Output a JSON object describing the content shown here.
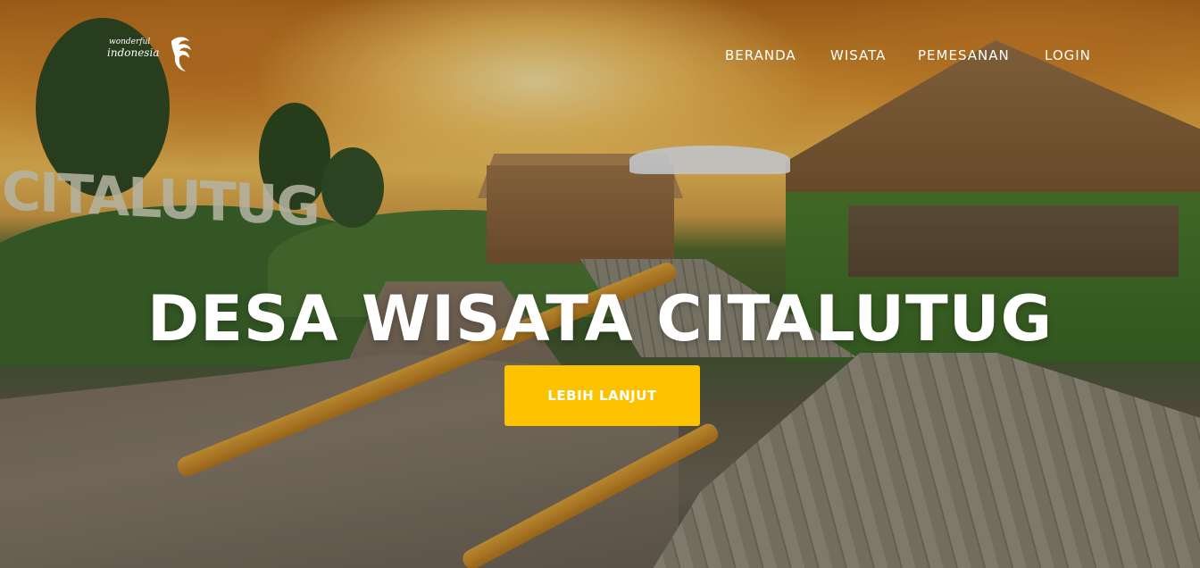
{
  "brand": {
    "logo_line1": "wonderful",
    "logo_line2": "indonesia",
    "logo_icon": "garuda-bird-logo-icon"
  },
  "nav": {
    "items": [
      {
        "label": "BERANDA"
      },
      {
        "label": "WISATA"
      },
      {
        "label": "PEMESANAN"
      },
      {
        "label": "LOGIN"
      }
    ]
  },
  "hero": {
    "title": "DESA WISATA CITALUTUG",
    "cta_label": "LEBIH LANJUT",
    "background_sign_text": "CITALUTUG"
  },
  "colors": {
    "cta_background": "#fcc200",
    "text": "#ffffff",
    "sky_gold": "#f2c058"
  }
}
